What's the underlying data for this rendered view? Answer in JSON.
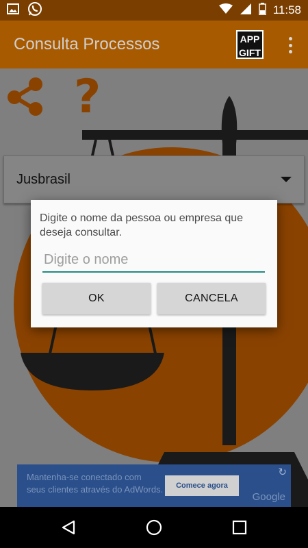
{
  "status_bar": {
    "time": "11:58",
    "icons": [
      "image-icon",
      "whatsapp-icon",
      "wifi-icon",
      "signal-icon",
      "battery-icon"
    ]
  },
  "action_bar": {
    "title": "Consulta Processos",
    "gift_logo_line1": "APP",
    "gift_logo_line2": "GIFT"
  },
  "toolbar_icons": [
    "share-icon",
    "help-icon"
  ],
  "help_glyph": "?",
  "spinner": {
    "selected": "Jusbrasil"
  },
  "dialog": {
    "message": "Digite o nome da pessoa ou empresa que deseja consultar.",
    "input_value": "",
    "input_placeholder": "Digite o nome",
    "ok_label": "OK",
    "cancel_label": "CANCELA"
  },
  "ad": {
    "line1": "Mantenha-se conectado com",
    "line2": "seus clientes através do AdWords.",
    "cta_label": "Comece agora",
    "brand": "Google",
    "refresh_glyph": "↻"
  },
  "colors": {
    "status_bar": "#7a3f00",
    "action_bar": "#a85a00",
    "accent_teal": "#1f8a82",
    "ad_background": "#2a4f8a"
  }
}
